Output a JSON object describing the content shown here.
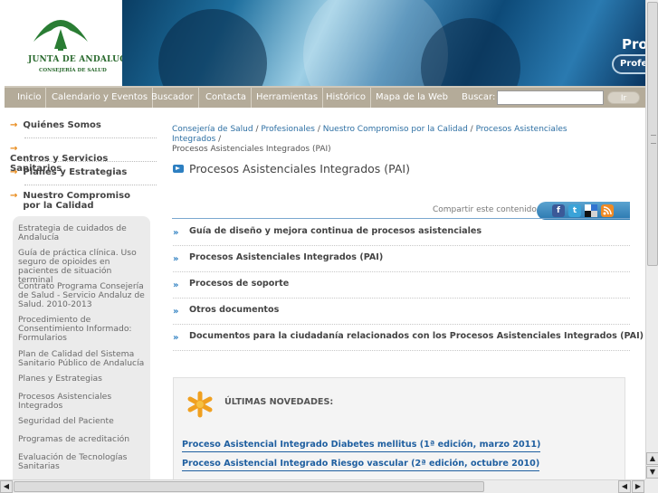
{
  "header": {
    "logo_name": "JUNTA DE ANDALUCIA",
    "logo_subtitle": "CONSEJERÍA DE SALUD",
    "banner_title": "Prof",
    "banner_button": "Profes"
  },
  "nav": {
    "items": [
      "Inicio",
      "Calendario y Eventos",
      "Buscador",
      "Contacta",
      "Herramientas",
      "Histórico",
      "Mapa de la Web"
    ],
    "search_label": "Buscar:",
    "search_value": "",
    "go_label": "Ir"
  },
  "sidebar": {
    "main_items": [
      "Quiénes Somos",
      "Centros y Servicios Sanitarios",
      "Planes y Estrategias",
      "Nuestro Compromiso por la Calidad"
    ],
    "sub_items": [
      "Estrategia de cuidados de Andalucía",
      "Guía de práctica clínica. Uso seguro de opioides en pacientes de situación terminal",
      "Contrato Programa Consejería de Salud - Servicio Andaluz de Salud. 2010-2013",
      "Procedimiento de Consentimiento Informado: Formularios",
      "Plan de Calidad del Sistema Sanitario Público de Andalucía",
      "Planes y Estrategias",
      "Procesos Asistenciales Integrados",
      "Seguridad del Paciente",
      "Programas de acreditación",
      "Evaluación de Tecnologías Sanitarias"
    ]
  },
  "breadcrumb": {
    "links": [
      "Consejería de Salud",
      "Profesionales",
      "Nuestro Compromiso por la Calidad",
      "Procesos Asistenciales Integrados"
    ],
    "separator": " / ",
    "current": "Procesos Asistenciales Integrados (PAI)"
  },
  "main": {
    "title": "Procesos Asistenciales Integrados (PAI)",
    "share_label": "Compartir este contenido:",
    "links": [
      "Guía de diseño y mejora continua de procesos asistenciales",
      "Procesos Asistenciales Integrados (PAI)",
      "Procesos de soporte",
      "Otros documentos",
      "Documentos para la ciudadanía relacionados con los Procesos Asistenciales Integrados (PAI)"
    ],
    "news": {
      "heading": "ÚLTIMAS NOVEDADES:",
      "items": [
        "Proceso Asistencial Integrado Diabetes mellitus (1ª edición, marzo 2011)",
        "Proceso Asistencial Integrado Riesgo vascular (2ª edición, octubre 2010)"
      ]
    }
  },
  "social_icons": [
    "facebook-icon",
    "twitter-icon",
    "delicious-icon",
    "rss-icon"
  ],
  "colors": {
    "nav_bar": "#b4ab99",
    "accent_orange": "#e88a1a",
    "link_blue": "#2d6fa3",
    "logo_green": "#2a6a2e"
  }
}
